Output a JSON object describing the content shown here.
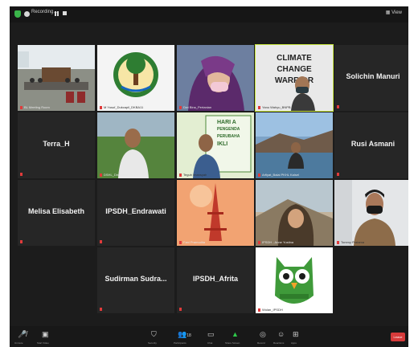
{
  "topbar": {
    "recording_label": "Recording...",
    "view_label": "View"
  },
  "tiles": {
    "t1": {
      "caption": "BL Meeting Room"
    },
    "t2": {
      "caption": "M Yusuf_Dukcapil_DKBA11"
    },
    "t3": {
      "caption": "Dwi Bina_Pertanian"
    },
    "t4": {
      "caption": "Yanu Wahyu_BNPB"
    },
    "t5": {
      "name": "Solichin Manuri"
    },
    "t6": {
      "name": "Terra_H"
    },
    "t7": {
      "caption": "DSHL_Direktorat IPSDH"
    },
    "t8": {
      "caption": "Teguh Imansyah"
    },
    "t9": {
      "caption": "Arfiyat_Balai PKHL Kalsel"
    },
    "t10": {
      "name": "Rusi Asmani"
    },
    "t11": {
      "name": "Melisa Elisabeth"
    },
    "t12": {
      "name": "IPSDH_Endrawati"
    },
    "t13": {
      "caption": "Fani Pramudita"
    },
    "t14": {
      "caption": "IPSDH - Anne Yustina"
    },
    "t15": {
      "caption": "Tommy Pratama"
    },
    "t16": {
      "name": "Sudirman  Sudra..."
    },
    "t17": {
      "name": "IPSDH_Afrita"
    },
    "t18": {
      "caption": "Wulan_IPSDH"
    }
  },
  "slide": {
    "line1": "CLIMATE",
    "line2": "CHANGE",
    "line3": "WARRIOR"
  },
  "banner": {
    "line1": "HARI A",
    "line2": "PENGENDA",
    "line3": "PERUBAHA",
    "line4": "IKLI"
  },
  "toolbar": {
    "unmute": "Unmute",
    "video": "Start Video",
    "security": "Security",
    "participants": "Participants",
    "participants_count": "18",
    "chat": "Chat",
    "share": "Share Screen",
    "record": "Record",
    "reactions": "Reactions",
    "apps": "Apps",
    "leave": "Leave"
  },
  "colors": {
    "accent": "#c8e63c",
    "leave": "#d63b3b",
    "share": "#2ec94a"
  }
}
